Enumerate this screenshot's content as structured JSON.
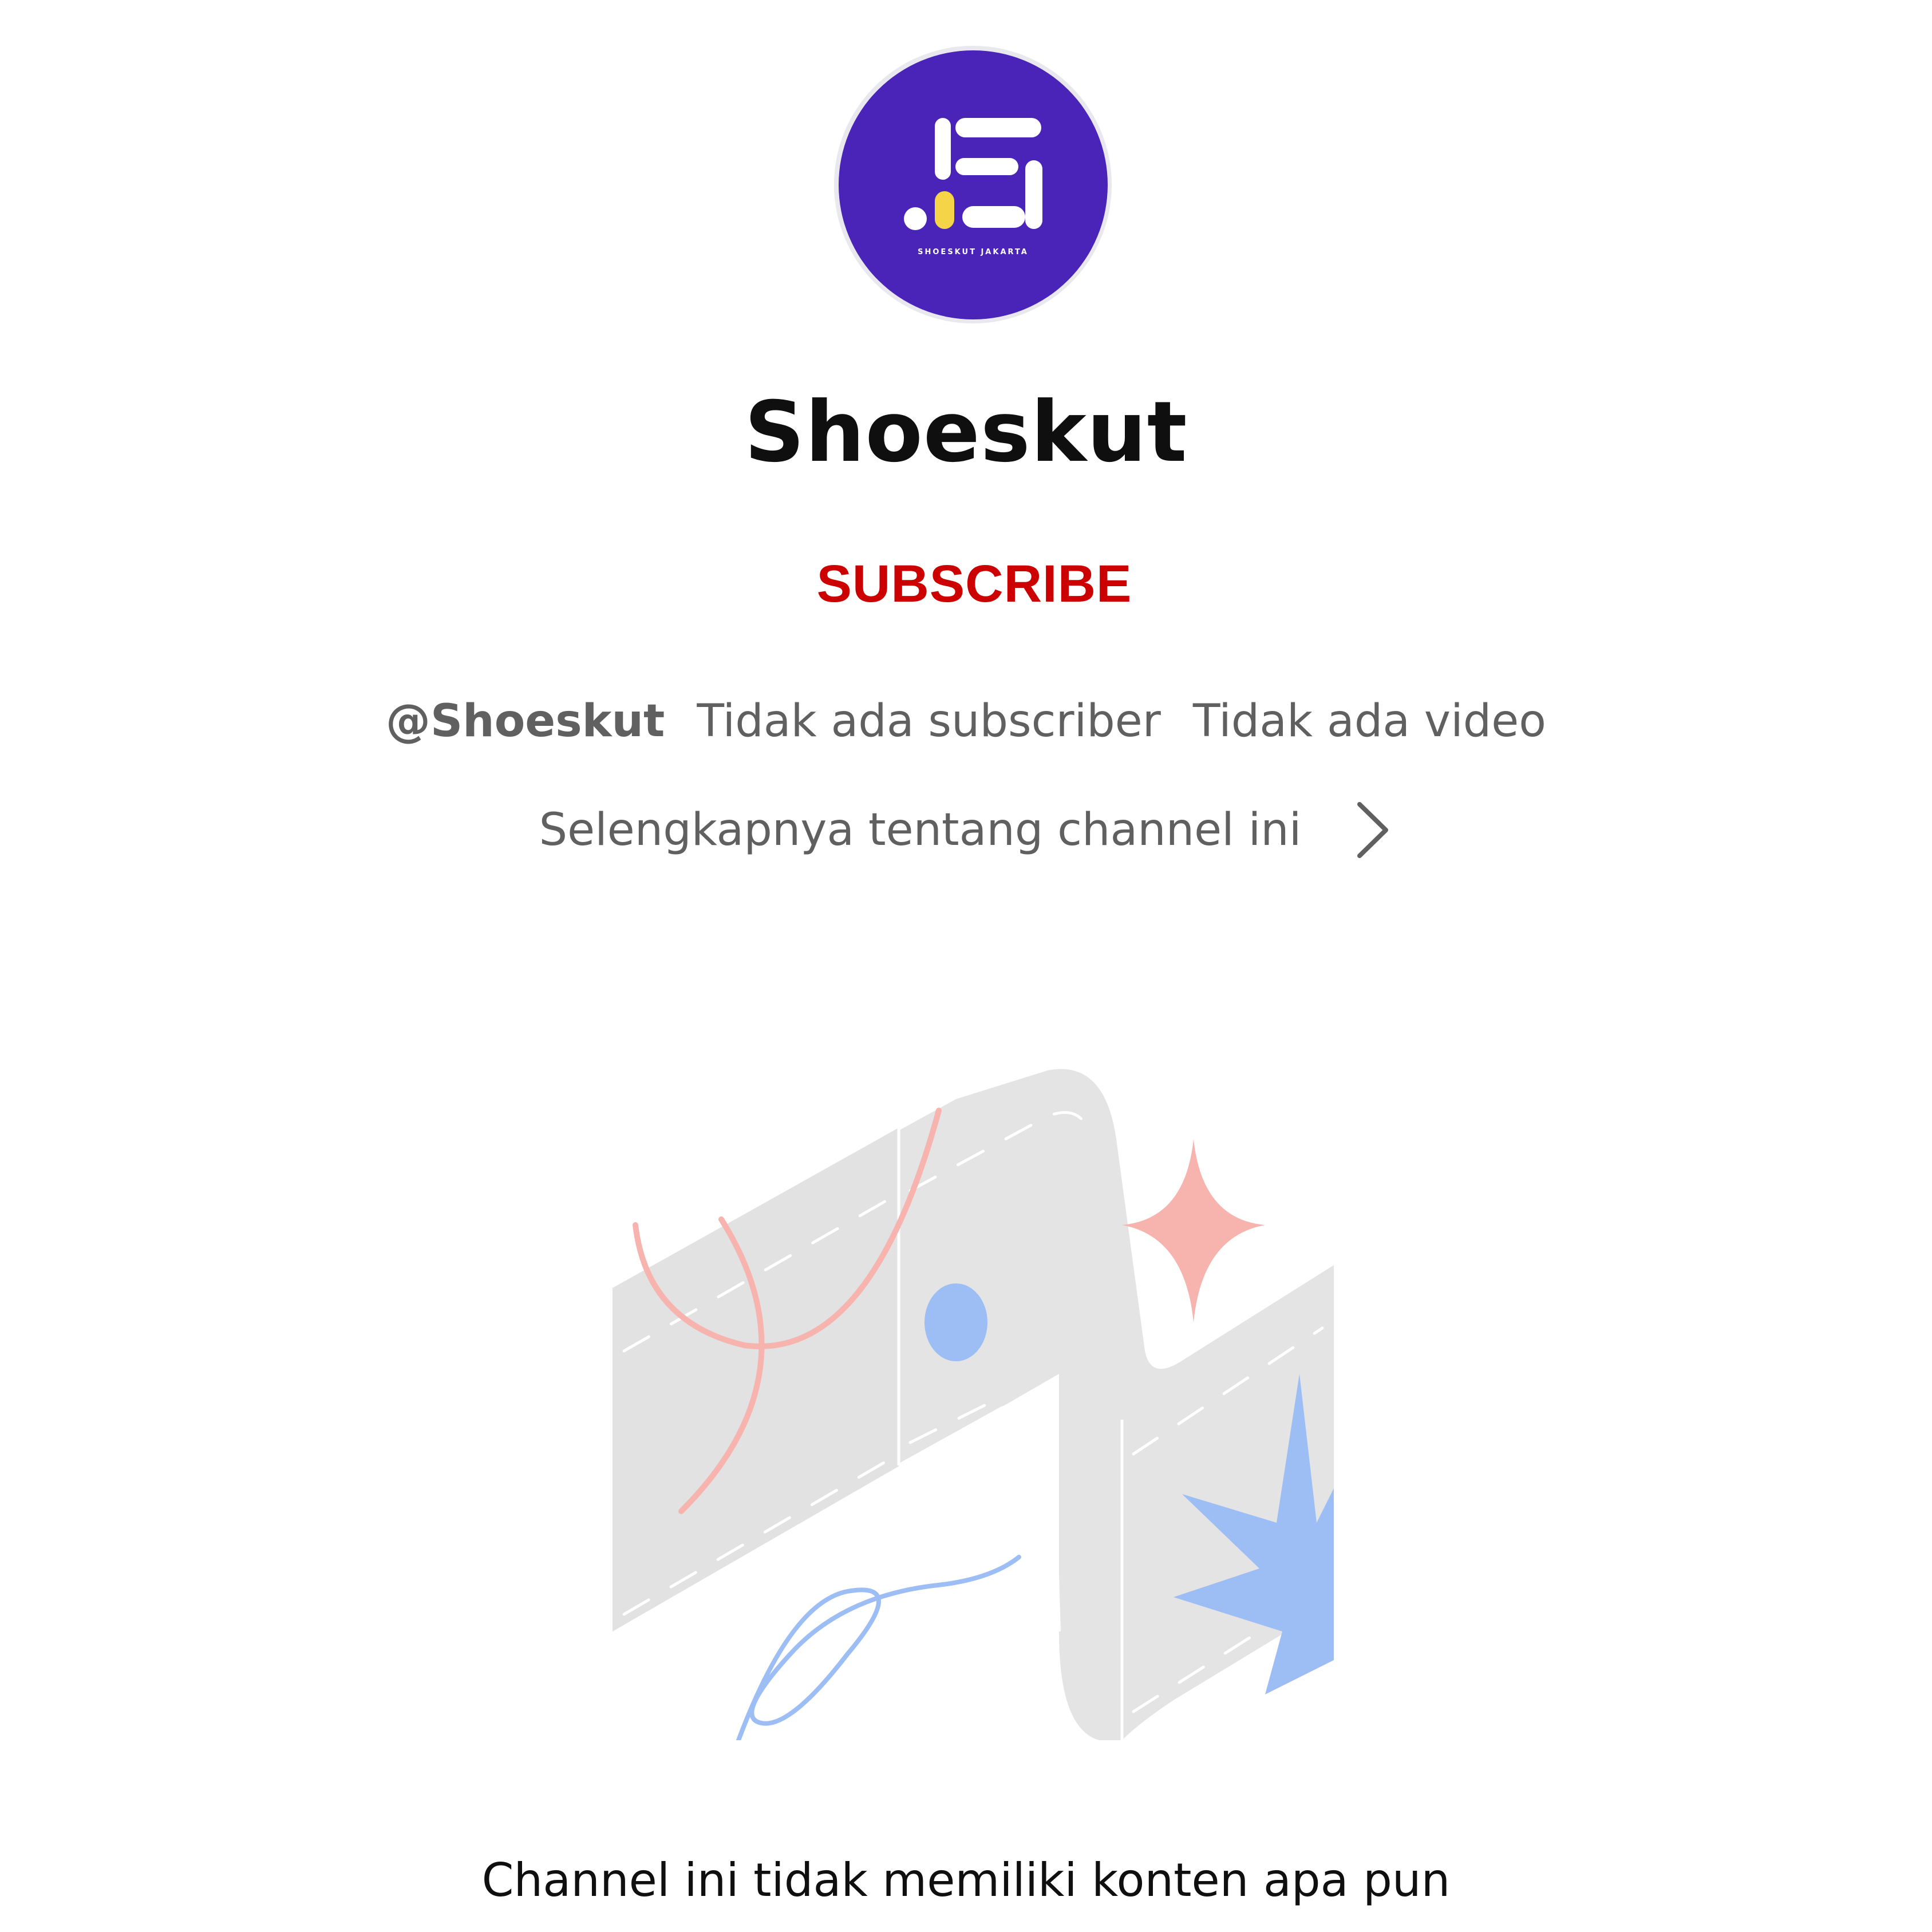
{
  "channel": {
    "name": "Shoeskut",
    "avatar_caption": "SHOESKUT JAKARTA",
    "handle": "@Shoeskut",
    "subscribers": "Tidak ada subscriber",
    "videos": "Tidak ada video",
    "more_about": "Selengkapnya tentang channel ini"
  },
  "actions": {
    "subscribe_label": "SUBSCRIBE"
  },
  "empty_state": {
    "message": "Channel ini tidak memiliki konten apa pun"
  },
  "icons": {
    "more_about": "chevron-right-icon",
    "avatar": "shoeskut-logo"
  },
  "colors": {
    "subscribe": "#cc0000",
    "avatar_bg": "#4a23b8",
    "secondary_text": "#606060",
    "primary_text": "#0f0f0f"
  }
}
